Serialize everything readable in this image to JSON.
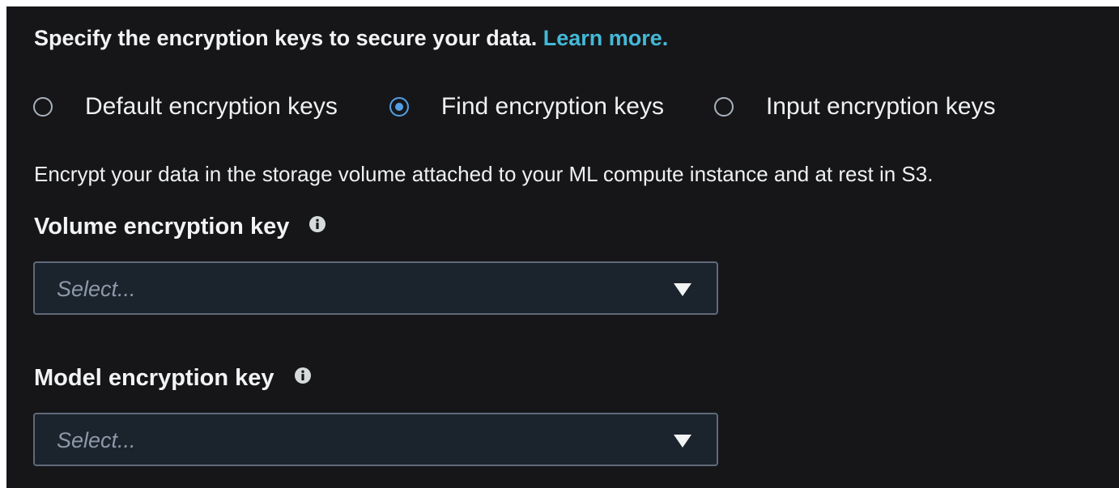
{
  "encryption": {
    "intro_text": "Specify the encryption keys to secure your data.",
    "learn_more": "Learn more.",
    "options": [
      {
        "label": "Default encryption keys",
        "selected": false
      },
      {
        "label": "Find encryption keys",
        "selected": true
      },
      {
        "label": "Input encryption keys",
        "selected": false
      }
    ],
    "description": "Encrypt your data in the storage volume attached to your ML compute instance and at rest in S3.",
    "volume_key": {
      "label": "Volume encryption key",
      "placeholder": "Select..."
    },
    "model_key": {
      "label": "Model encryption key",
      "placeholder": "Select..."
    }
  },
  "colors": {
    "background": "#161619",
    "link": "#44b9d6",
    "radio_selected": "#539fe5",
    "select_background": "#1b232d",
    "select_border": "#5f6b7a"
  },
  "icons": {
    "radio": "radio-circle",
    "info": "info-icon",
    "dropdown": "caret-down-icon"
  }
}
